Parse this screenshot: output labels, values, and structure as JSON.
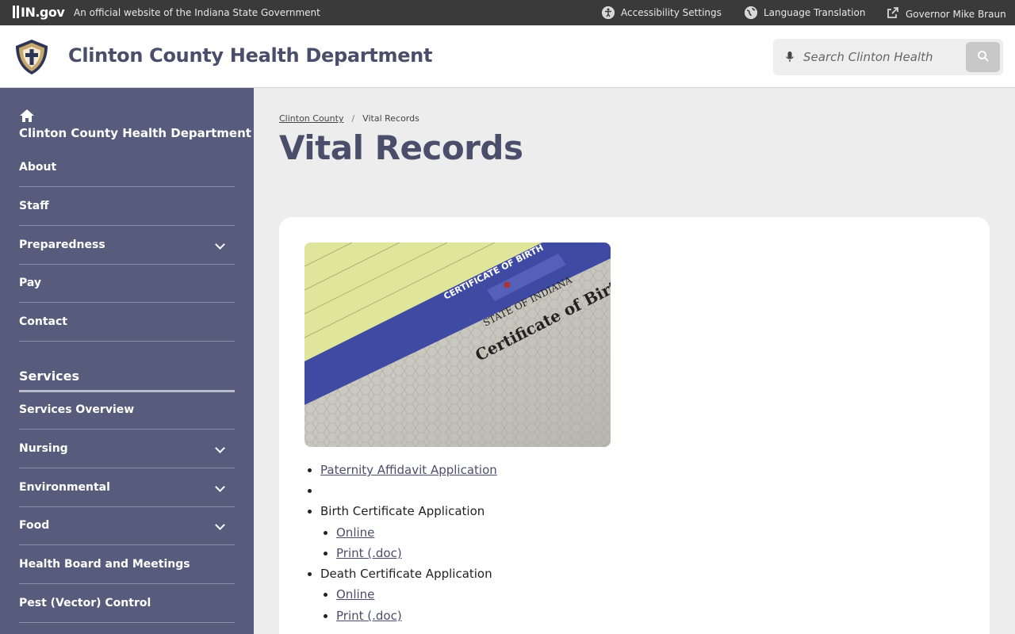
{
  "topbar": {
    "logo": "IN.gov",
    "official_text": "An official website of the Indiana State Government",
    "accessibility": "Accessibility Settings",
    "language": "Language Translation",
    "governor": "Governor Mike Braun"
  },
  "header": {
    "site_title": "Clinton County Health Department",
    "search_placeholder": "Search Clinton Health"
  },
  "sidebar": {
    "home_title": "Clinton County Health Department",
    "items": [
      {
        "label": "About",
        "has_submenu": false
      },
      {
        "label": "Staff",
        "has_submenu": false
      },
      {
        "label": "Preparedness",
        "has_submenu": true
      },
      {
        "label": "Pay",
        "has_submenu": false
      },
      {
        "label": "Contact",
        "has_submenu": false
      }
    ],
    "section_title": "Services",
    "services": [
      {
        "label": "Services Overview",
        "has_submenu": false
      },
      {
        "label": "Nursing",
        "has_submenu": true
      },
      {
        "label": "Environmental",
        "has_submenu": true
      },
      {
        "label": "Food",
        "has_submenu": true
      },
      {
        "label": "Health Board and Meetings",
        "has_submenu": false
      },
      {
        "label": "Pest (Vector) Control",
        "has_submenu": false
      }
    ]
  },
  "breadcrumb": {
    "parent": "Clinton County",
    "current": "Vital Records"
  },
  "page": {
    "title": "Vital Records",
    "image_text": {
      "top_band": "CERTIFICATE OF BIRTH",
      "state": "STATE OF INDIANA",
      "script": "Certificate of Birth"
    },
    "links": {
      "paternity": "Paternity Affidavit Application",
      "birth_heading": "Birth Certificate Application",
      "birth_online": "Online",
      "birth_print": "Print (.doc)",
      "death_heading": "Death Certificate Application",
      "death_online": "Online",
      "death_print": "Print (.doc)"
    }
  },
  "colors": {
    "topbar_bg": "#3a3a3a",
    "sidebar_bg": "#575b7c",
    "title_color": "#4a4e6a",
    "page_bg": "#ededed"
  }
}
